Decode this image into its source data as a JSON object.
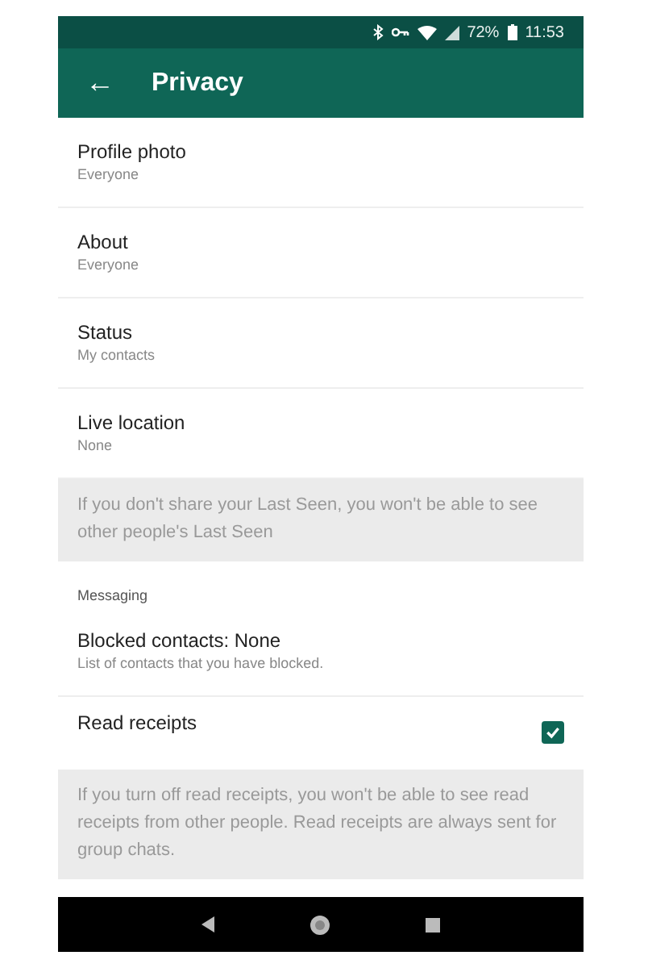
{
  "status_bar": {
    "battery": "72%",
    "time": "11:53"
  },
  "app_bar": {
    "back": "←",
    "title": "Privacy"
  },
  "items": [
    {
      "kind": "setting",
      "title": "Profile photo",
      "subtitle": "Everyone"
    },
    {
      "kind": "setting",
      "title": "About",
      "subtitle": "Everyone"
    },
    {
      "kind": "setting",
      "title": "Status",
      "subtitle": "My contacts"
    },
    {
      "kind": "setting",
      "title": "Live location",
      "subtitle": "None"
    },
    {
      "kind": "note",
      "text": "If you don't share your Last Seen, you won't be able to see other people's Last Seen"
    },
    {
      "kind": "header",
      "text": "Messaging"
    },
    {
      "kind": "setting",
      "title": "Blocked contacts: None",
      "subtitle": "List of contacts that you have blocked."
    },
    {
      "kind": "checkbox",
      "title": "Read receipts",
      "checked": true
    },
    {
      "kind": "note",
      "text": "If you turn off read receipts, you won't be able to see read receipts from other people. Read receipts are always sent for group chats."
    }
  ]
}
